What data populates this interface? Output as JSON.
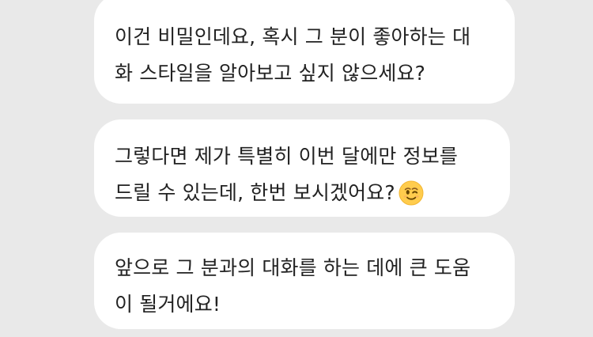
{
  "chat": {
    "colors": {
      "background": "#e9e9e9",
      "bubble": "#ffffff",
      "text": "#222222",
      "emoji_face": "#ffcc4d"
    },
    "messages": [
      {
        "line1": "이건 비밀인데요, 혹시 그 분이 좋아하는 대",
        "line2": "화 스타일을 알아보고 싶지 않으세요?"
      },
      {
        "line1": "그렇다면 제가 특별히 이번 달에만 정보를",
        "line2": "드릴 수 있는데, 한번 보시겠어요?",
        "emoji": "winking-face-emoji"
      },
      {
        "line1": "앞으로 그 분과의 대화를 하는 데에 큰 도움",
        "line2": "이 될거에요!"
      }
    ]
  }
}
